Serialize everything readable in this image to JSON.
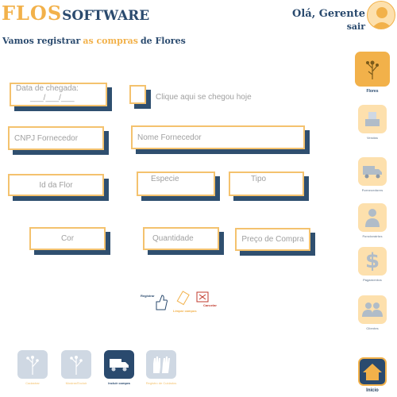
{
  "brand": {
    "part1": "FLOS",
    "part2": "SOFTWARE"
  },
  "user": {
    "greeting": "Olá, Gerente",
    "logout": "sair"
  },
  "headline": {
    "prefix": "Vamos registrar",
    "highlight": "as compras",
    "suffix": "de Flores"
  },
  "form": {
    "date_placeholder_line1": "Data de chegada:",
    "date_placeholder_line2": "___/___/___",
    "today_checkbox_label": "Clique aqui se chegou hoje",
    "cnpj_placeholder": "CNPJ Fornecedor",
    "supplier_name_placeholder": "Nome Fornecedor",
    "flower_id_placeholder": "Id da Flor",
    "species_placeholder": "Especie",
    "type_placeholder": "Tipo",
    "color_placeholder": "Cor",
    "quantity_placeholder": "Quantidade",
    "price_placeholder": "Preço de Compra"
  },
  "actions": {
    "register": "Registrar",
    "clear": "Limpar campos",
    "cancel": "Cancelar"
  },
  "sidebar": [
    {
      "label": "Flores",
      "icon": "flower-icon",
      "active": true
    },
    {
      "label": "Vendas",
      "icon": "sales-icon"
    },
    {
      "label": "Fornecedores",
      "icon": "truck-icon"
    },
    {
      "label": "Funcionários",
      "icon": "employee-icon"
    },
    {
      "label": "Pagamentos",
      "icon": "dollar-icon"
    },
    {
      "label": "Clientes",
      "icon": "clients-icon"
    },
    {
      "label": "Início",
      "icon": "home-icon"
    }
  ],
  "bottom_nav": [
    {
      "label": "Cadastrar",
      "icon": "flower-icon"
    },
    {
      "label": "Mostrar/Excluir",
      "icon": "flower-icon"
    },
    {
      "label": "Incluir compra",
      "icon": "truck-icon",
      "active": true
    },
    {
      "label": "Registro de Cuidados",
      "icon": "gloves-icon"
    }
  ],
  "colors": {
    "accent": "#f2b14a",
    "navy": "#2a4a6e",
    "shadow": "#2f4f6f",
    "light": "#fde0ad"
  }
}
